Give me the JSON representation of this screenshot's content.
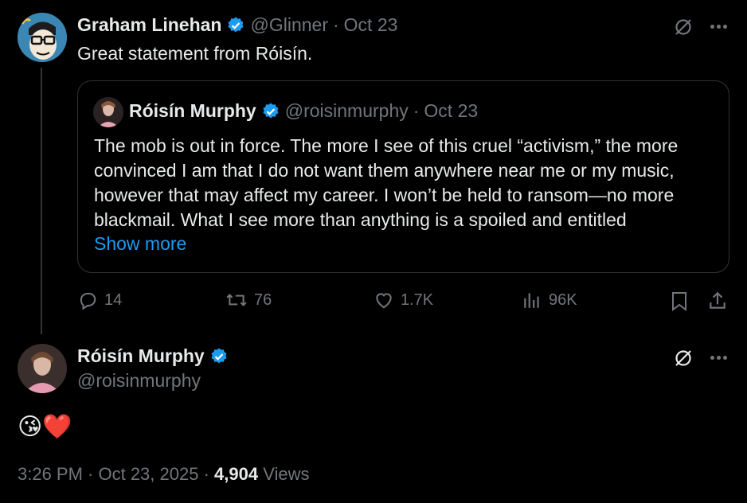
{
  "tweet": {
    "author_name": "Graham Linehan",
    "handle": "@Glinner",
    "date": "Oct 23",
    "text": "Great statement from Róisín.",
    "quote": {
      "author_name": "Róisín Murphy",
      "handle": "@roisinmurphy",
      "date": "Oct 23",
      "text": "The mob is out in force. The more I see of this cruel “activism,” the more convinced I am that I do not want them anywhere near me or my music, however that may affect my career. I won’t be held to ransom—no more blackmail. What I see more than anything is a spoiled and entitled",
      "show_more": "Show more"
    },
    "actions": {
      "replies": "14",
      "reposts": "76",
      "likes": "1.7K",
      "views": "96K"
    }
  },
  "reply": {
    "author_name": "Róisín Murphy",
    "handle": "@roisinmurphy",
    "text": "😘❤️",
    "time": "3:26 PM · Oct 23, 2025 · ",
    "views_count": "4,904",
    "views_label": " Views"
  },
  "colors": {
    "accent": "#1d9bf0",
    "muted": "#71767b",
    "bg": "#000000"
  }
}
